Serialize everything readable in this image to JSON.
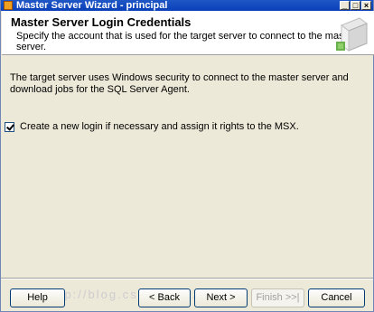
{
  "window": {
    "title": "Master Server Wizard - principal"
  },
  "banner": {
    "title": "Master Server Login Credentials",
    "subtitle": "Specify the account that is used for the target server to connect to the master server."
  },
  "content": {
    "description": "The target server uses Windows security to connect to the master server and download jobs for the SQL Server Agent.",
    "checkbox_label": "Create a new login if necessary and assign it rights to the MSX.",
    "checkbox_checked": true
  },
  "buttons": {
    "help": "Help",
    "back": "< Back",
    "next": "Next >",
    "finish": "Finish >>|",
    "cancel": "Cancel"
  },
  "watermark": "http://blog.csdn.net/..."
}
